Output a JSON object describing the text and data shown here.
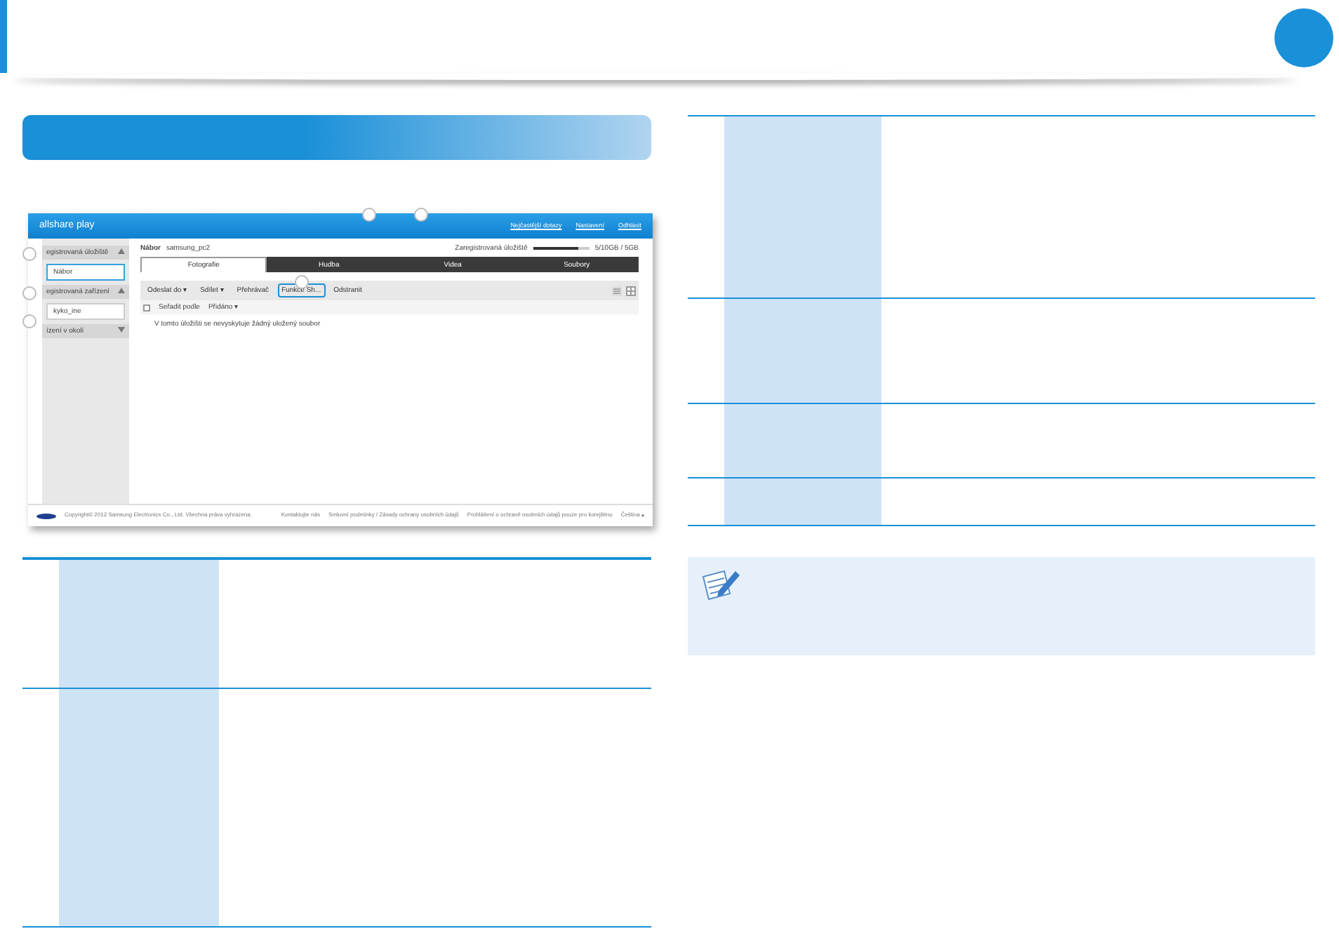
{
  "app": {
    "logo": "allshare play",
    "header_links": [
      "Nejčastější dotazy",
      "Nastavení",
      "Odhlásit"
    ],
    "location_label": "Nábor",
    "location_value": "samsung_pc2",
    "storage_label": "Zaregistrovaná úložiště",
    "storage_level": {
      "level": 0.8
    },
    "storage_reading": "5/10GB / 5GB",
    "sidebar": [
      {
        "kind": "header",
        "label": "egistrovaná úložiště",
        "expanded": true
      },
      {
        "kind": "item",
        "label": "Nábor",
        "selected": true
      },
      {
        "kind": "header",
        "label": "egistrovaná zařízení",
        "expanded": true
      },
      {
        "kind": "item",
        "label": "kyko_ine",
        "selected": false
      },
      {
        "kind": "header",
        "label": "ízení v okolí",
        "expanded": false
      }
    ],
    "tabs": [
      {
        "label": "Fotografie",
        "selected": true
      },
      {
        "label": "Hudba",
        "selected": false
      },
      {
        "label": "Videa",
        "selected": false
      },
      {
        "label": "Soubory",
        "selected": false
      }
    ],
    "toolbar": [
      {
        "label": "Odeslat do ▾",
        "highlighted": false
      },
      {
        "label": "Sdílet ▾",
        "highlighted": false
      },
      {
        "label": "Přehrávač",
        "highlighted": false
      },
      {
        "label": "Funkce Sh...",
        "highlighted": true
      },
      {
        "label": "Odstranit",
        "highlighted": false
      }
    ],
    "views": [
      {
        "kind": "list",
        "selected": false
      },
      {
        "kind": "grid",
        "selected": true
      }
    ],
    "select_all_checked": false,
    "sort_label": "Seřadit podle",
    "sort_value": "Přidáno ▾",
    "empty_message": "V tomto úložišti se nevyskytuje žádný uložený soubor",
    "copyright": "Copyright© 2012 Samsung Electronics Co., Ltd. Všechna práva vyhrazena.",
    "footer_links": [
      "Kontaktujte nás",
      "Smluvní podmínky / Zásady ochrany osobních údajů",
      "Prohlášení o ochraně osobních údajů pouze pro korejštinu",
      "Čeština ▴"
    ]
  }
}
